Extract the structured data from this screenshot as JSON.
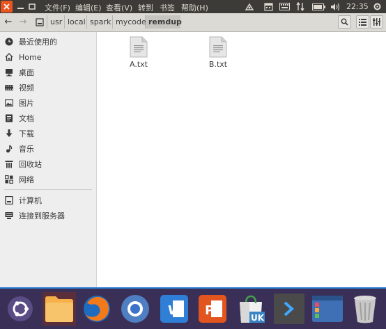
{
  "topbar": {
    "menus": [
      "文件(F)",
      "编辑(E)",
      "查看(V)",
      "转到",
      "书签",
      "帮助(H)"
    ],
    "clock": "22:35",
    "tray_icons": [
      "app-indicator-icon",
      "calendar-icon",
      "keyboard-icon",
      "network-icon",
      "battery-icon",
      "volume-icon",
      "settings-icon"
    ]
  },
  "toolbar": {
    "breadcrumb": [
      "usr",
      "local",
      "spark",
      "mycode",
      "remdup"
    ],
    "active_crumb": "remdup"
  },
  "sidebar": {
    "items": [
      {
        "label": "最近使用的",
        "icon": "recent-icon"
      },
      {
        "label": "Home",
        "icon": "home-icon"
      },
      {
        "label": "桌面",
        "icon": "desktop-icon"
      },
      {
        "label": "视频",
        "icon": "video-icon"
      },
      {
        "label": "图片",
        "icon": "pictures-icon"
      },
      {
        "label": "文档",
        "icon": "documents-icon"
      },
      {
        "label": "下载",
        "icon": "download-icon"
      },
      {
        "label": "音乐",
        "icon": "music-icon"
      },
      {
        "label": "回收站",
        "icon": "trash-icon"
      },
      {
        "label": "网络",
        "icon": "network-icon"
      }
    ],
    "devices": [
      {
        "label": "计算机",
        "icon": "computer-icon"
      },
      {
        "label": "连接到服务器",
        "icon": "server-icon"
      }
    ]
  },
  "files": [
    {
      "name": "A.txt",
      "icon": "text-file-icon"
    },
    {
      "name": "B.txt",
      "icon": "text-file-icon"
    }
  ],
  "dock": {
    "items": [
      "ubuntu-logo-icon",
      "files-app-icon",
      "firefox-icon",
      "chromium-icon",
      "wps-writer-icon",
      "wps-presentation-icon",
      "ubuntu-kylin-store-icon",
      "terminal-icon",
      "workspace-switcher-icon",
      "trash-icon"
    ],
    "active_item": "files-app-icon"
  },
  "colors": {
    "accent": "#e95420",
    "panel": "#3c3b37",
    "dock": "#3a2f57",
    "sidebar": "#eeeeee"
  }
}
